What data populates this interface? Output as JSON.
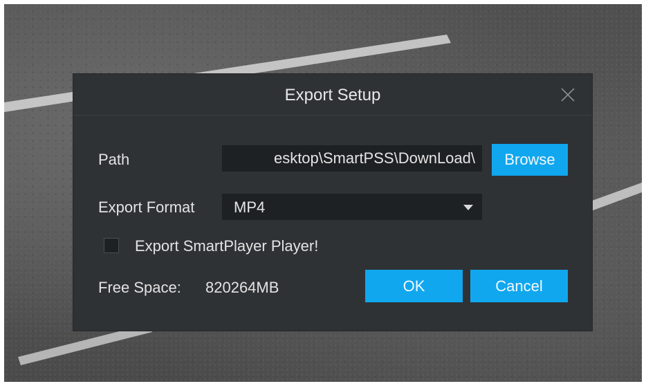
{
  "dialog": {
    "title": "Export Setup",
    "close_icon": "close-icon"
  },
  "path": {
    "label": "Path",
    "value": "esktop\\SmartPSS\\DownLoad\\",
    "browse_label": "Browse"
  },
  "format": {
    "label": "Export Format",
    "selected": "MP4",
    "caret_icon": "chevron-down-icon"
  },
  "smartplayer": {
    "label": "Export SmartPlayer Player!",
    "checked": false
  },
  "free_space": {
    "label": "Free Space:",
    "value": "820264MB"
  },
  "actions": {
    "ok_label": "OK",
    "cancel_label": "Cancel"
  },
  "colors": {
    "accent": "#10a7ef",
    "dialog_bg": "#2f3235",
    "field_bg": "#1e2124",
    "text": "#e3e3e3"
  }
}
